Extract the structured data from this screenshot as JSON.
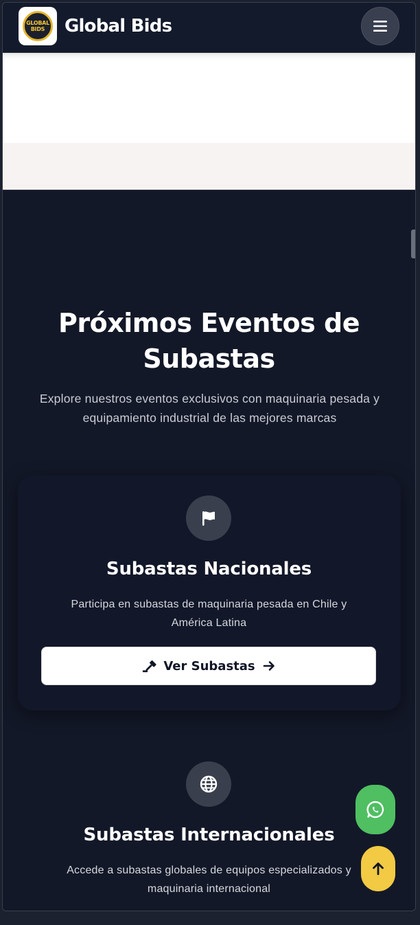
{
  "header": {
    "brand": "Global Bids",
    "logo_text": [
      "GLOBAL",
      "BIDS"
    ]
  },
  "events": {
    "title_line1": "Próximos Eventos de",
    "title_line2": "Subastas",
    "subtitle_line1": "Explore nuestros eventos exclusivos con maquinaria pesada y",
    "subtitle_line2": "equipamiento industrial de las mejores marcas"
  },
  "cards": [
    {
      "icon": "flag-icon",
      "title": "Subastas Nacionales",
      "desc_line1": "Participa en subastas de maquinaria pesada en Chile y",
      "desc_line2": "América Latina",
      "button": "Ver Subastas"
    },
    {
      "icon": "globe-icon",
      "title": "Subastas Internacionales",
      "desc_line1": "Accede a subastas globales de equipos especializados y",
      "desc_line2": "maquinaria internacional"
    }
  ],
  "colors": {
    "dark_bg": "#131828",
    "whatsapp": "#4fbf62",
    "back_to_top": "#f2ca43"
  }
}
